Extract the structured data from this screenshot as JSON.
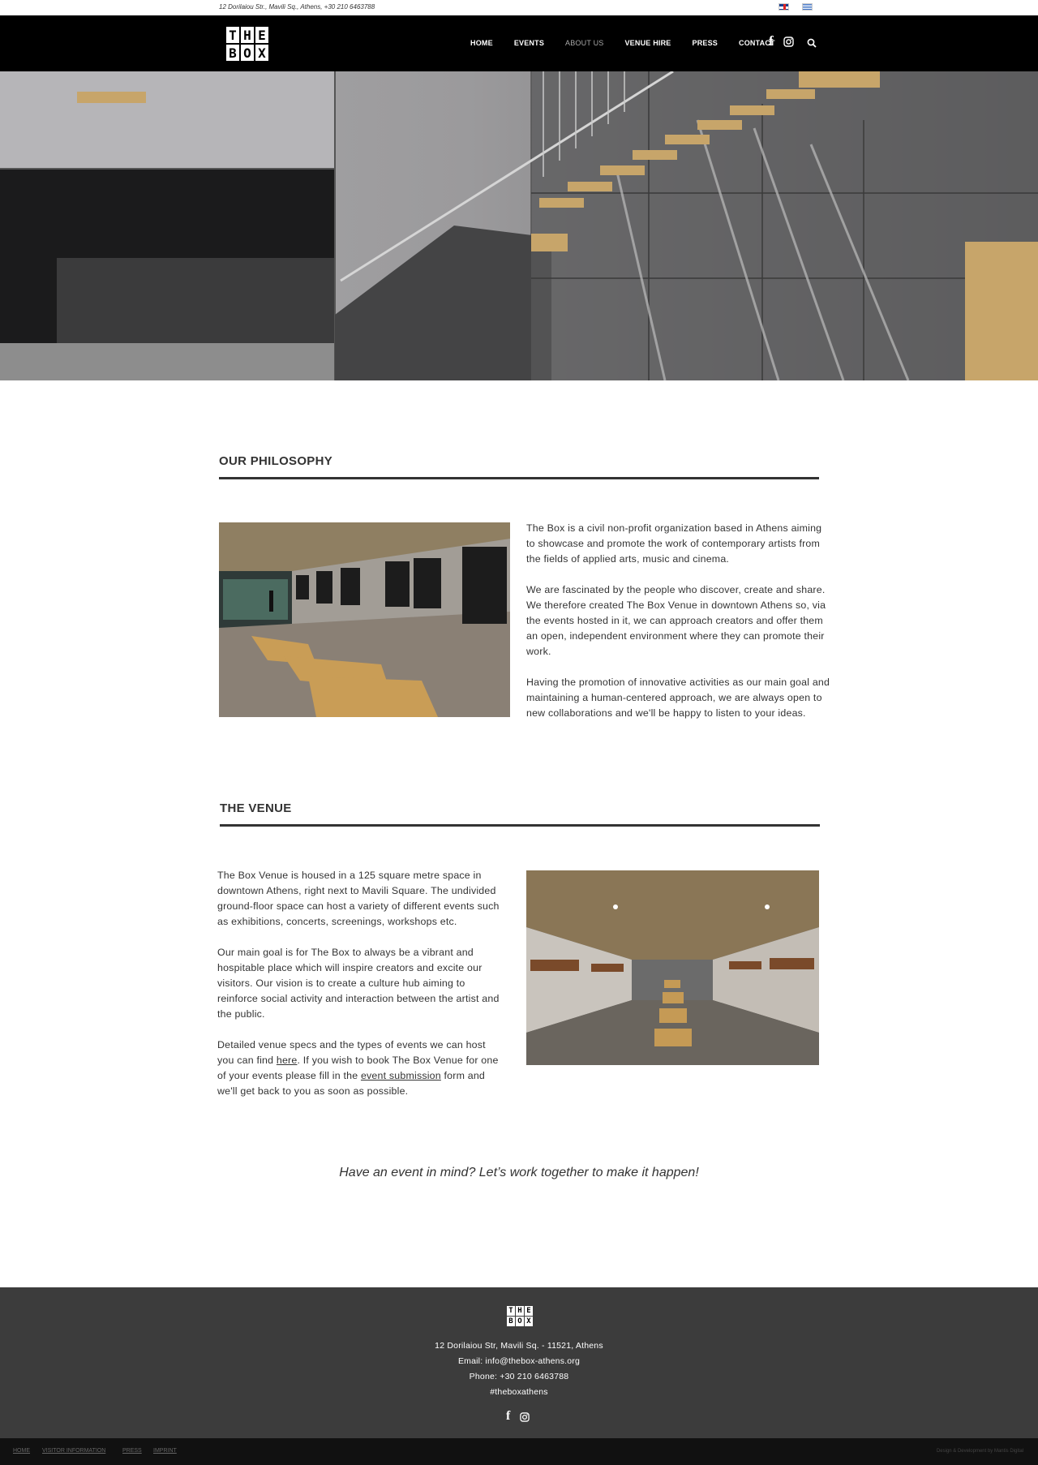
{
  "topbar": {
    "address": "12 Dorilaiou Str., Mavili Sq., Athens, +30 210 6463788",
    "flags": [
      "uk-flag",
      "greek-flag"
    ]
  },
  "header": {
    "logo_letters": [
      "T",
      "H",
      "E",
      "B",
      "O",
      "X"
    ],
    "nav": [
      {
        "label": "HOME",
        "active": false
      },
      {
        "label": "EVENTS",
        "active": false
      },
      {
        "label": "ABOUT US",
        "active": true
      },
      {
        "label": "VENUE HIRE",
        "active": false
      },
      {
        "label": "PRESS",
        "active": false
      },
      {
        "label": "CONTACT",
        "active": false
      }
    ],
    "icons": [
      "facebook-icon",
      "instagram-icon",
      "search-icon"
    ]
  },
  "philosophy": {
    "title": "OUR PHILOSOPHY",
    "paragraphs": [
      "The Box is a civil non-profit organization based in Athens aiming to showcase and promote the work of contemporary artists from the fields of applied arts, music and cinema.",
      "We are fascinated by the people who discover, create and share. We therefore created The Box Venue in downtown Athens so, via the events hosted in it, we can approach creators and offer them an open, independent environment where they can promote their work.",
      "Having the promotion of innovative activities as our main goal and maintaining a human-centered approach, we are always open to new collaborations and we'll be happy to listen to your ideas."
    ]
  },
  "venue": {
    "title": "THE VENUE",
    "p1": "The Box Venue is housed in a 125 square metre space in downtown Athens, right next to Mavili Square. The undivided ground-floor space can host a variety of different events such as exhibitions, concerts, screenings, workshops etc.",
    "p2": "Our main goal is for The Box to always be a vibrant and hospitable place which will inspire creators and excite our visitors. Our vision is to create a culture hub aiming to reinforce social activity and interaction between the artist and the public.",
    "p3_a": "Detailed venue specs and the types of events we can host you can find ",
    "p3_link1": "here",
    "p3_b": ". If you wish to book The Box Venue for one of your events please fill in the ",
    "p3_link2": "event submission",
    "p3_c": " form and we'll get back to you as soon as possible."
  },
  "cta": "Have an event in mind? Let’s work together to make it happen!",
  "footer": {
    "address": "12 Dorilaiou Str, Mavili Sq. - 11521, Athens",
    "email": "Email: info@thebox-athens.org",
    "phone": "Phone: +30 210 6463788",
    "hashtag": "#theboxathens"
  },
  "bottombar": {
    "links": [
      "HOME",
      "VISITOR INFORMATION",
      "PRESS",
      "IMPRINT"
    ],
    "credit": "Design & Development by Mantis Digital"
  }
}
